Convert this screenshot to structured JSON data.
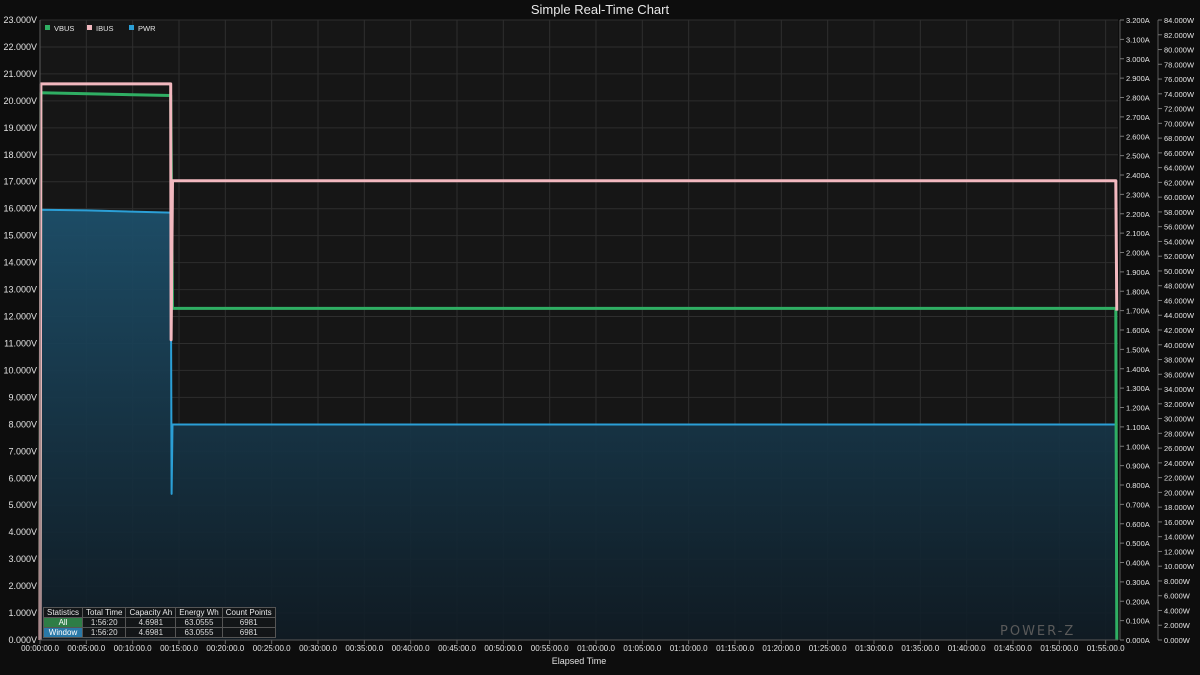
{
  "title": "Simple Real-Time Chart",
  "chart_data": {
    "type": "line",
    "xlabel": "Elapsed Time",
    "x_ticks": [
      "00:00:00.0",
      "00:05:00.0",
      "00:10:00.0",
      "00:15:00.0",
      "00:20:00.0",
      "00:25:00.0",
      "00:30:00.0",
      "00:35:00.0",
      "00:40:00.0",
      "00:45:00.0",
      "00:50:00.0",
      "00:55:00.0",
      "01:00:00.0",
      "01:05:00.0",
      "01:10:00.0",
      "01:15:00.0",
      "01:20:00.0",
      "01:25:00.0",
      "01:30:00.0",
      "01:35:00.0",
      "01:40:00.0",
      "01:45:00.0",
      "01:50:00.0",
      "01:55:00.0"
    ],
    "x_range_minutes": [
      0,
      116.333
    ],
    "y_left": {
      "unit": "V",
      "range": [
        0,
        23
      ],
      "ticks": [
        "0.000V",
        "1.000V",
        "2.000V",
        "3.000V",
        "4.000V",
        "5.000V",
        "6.000V",
        "7.000V",
        "8.000V",
        "9.000V",
        "10.000V",
        "11.000V",
        "12.000V",
        "13.000V",
        "14.000V",
        "15.000V",
        "16.000V",
        "17.000V",
        "18.000V",
        "19.000V",
        "20.000V",
        "21.000V",
        "22.000V",
        "23.000V"
      ]
    },
    "y_right1": {
      "unit": "A",
      "range": [
        0,
        3.2
      ],
      "ticks": [
        "0.000A",
        "0.100A",
        "0.200A",
        "0.300A",
        "0.400A",
        "0.500A",
        "0.600A",
        "0.700A",
        "0.800A",
        "0.900A",
        "1.000A",
        "1.100A",
        "1.200A",
        "1.300A",
        "1.400A",
        "1.500A",
        "1.600A",
        "1.700A",
        "1.800A",
        "1.900A",
        "2.000A",
        "2.100A",
        "2.200A",
        "2.300A",
        "2.400A",
        "2.500A",
        "2.600A",
        "2.700A",
        "2.800A",
        "2.900A",
        "3.000A",
        "3.100A",
        "3.200A"
      ]
    },
    "y_right2": {
      "unit": "W",
      "range": [
        0,
        84
      ],
      "ticks": [
        "0.000W",
        "2.000W",
        "4.000W",
        "6.000W",
        "8.000W",
        "10.000W",
        "12.000W",
        "14.000W",
        "16.000W",
        "18.000W",
        "20.000W",
        "22.000W",
        "24.000W",
        "26.000W",
        "28.000W",
        "30.000W",
        "32.000W",
        "34.000W",
        "36.000W",
        "38.000W",
        "40.000W",
        "42.000W",
        "44.000W",
        "46.000W",
        "48.000W",
        "50.000W",
        "52.000W",
        "54.000W",
        "56.000W",
        "58.000W",
        "60.000W",
        "62.000W",
        "64.000W",
        "66.000W",
        "68.000W",
        "70.000W",
        "72.000W",
        "74.000W",
        "76.000W",
        "78.000W",
        "80.000W",
        "82.000W",
        "84.000W"
      ]
    },
    "grid": true,
    "legend_position": "top-left",
    "series": [
      {
        "name": "VBUS",
        "axis": "y_left",
        "color": "#2fae63",
        "points": [
          [
            0,
            0
          ],
          [
            0.1,
            20.3
          ],
          [
            7,
            20.25
          ],
          [
            14.1,
            20.2
          ],
          [
            14.3,
            12.3
          ],
          [
            116.1,
            12.3
          ],
          [
            116.2,
            0
          ]
        ]
      },
      {
        "name": "IBUS",
        "axis": "y_right1",
        "color": "#f2b8bf",
        "points": [
          [
            0,
            0
          ],
          [
            0.1,
            2.87
          ],
          [
            14.1,
            2.87
          ],
          [
            14.15,
            1.55
          ],
          [
            14.3,
            2.37
          ],
          [
            116.1,
            2.37
          ],
          [
            116.2,
            1.7
          ]
        ]
      },
      {
        "name": "PWR",
        "axis": "y_right2",
        "color": "#2b9fd6",
        "points": [
          [
            0,
            0
          ],
          [
            0.1,
            58.3
          ],
          [
            5,
            58.2
          ],
          [
            14.1,
            57.9
          ],
          [
            14.15,
            40.5
          ],
          [
            14.2,
            19.8
          ],
          [
            14.3,
            29.2
          ],
          [
            116.1,
            29.2
          ],
          [
            116.2,
            0
          ]
        ]
      }
    ]
  },
  "stats_table": {
    "headers": [
      "Statistics",
      "Total Time",
      "Capacity Ah",
      "Energy Wh",
      "Count Points"
    ],
    "rows": [
      {
        "label": "All",
        "label_color": "#2e7d46",
        "values": [
          "1:56:20",
          "4.6981",
          "63.0555",
          "6981"
        ]
      },
      {
        "label": "Window",
        "label_color": "#2a79a8",
        "values": [
          "1:56:20",
          "4.6981",
          "63.0555",
          "6981"
        ]
      }
    ]
  },
  "watermark": "POWER-Z"
}
